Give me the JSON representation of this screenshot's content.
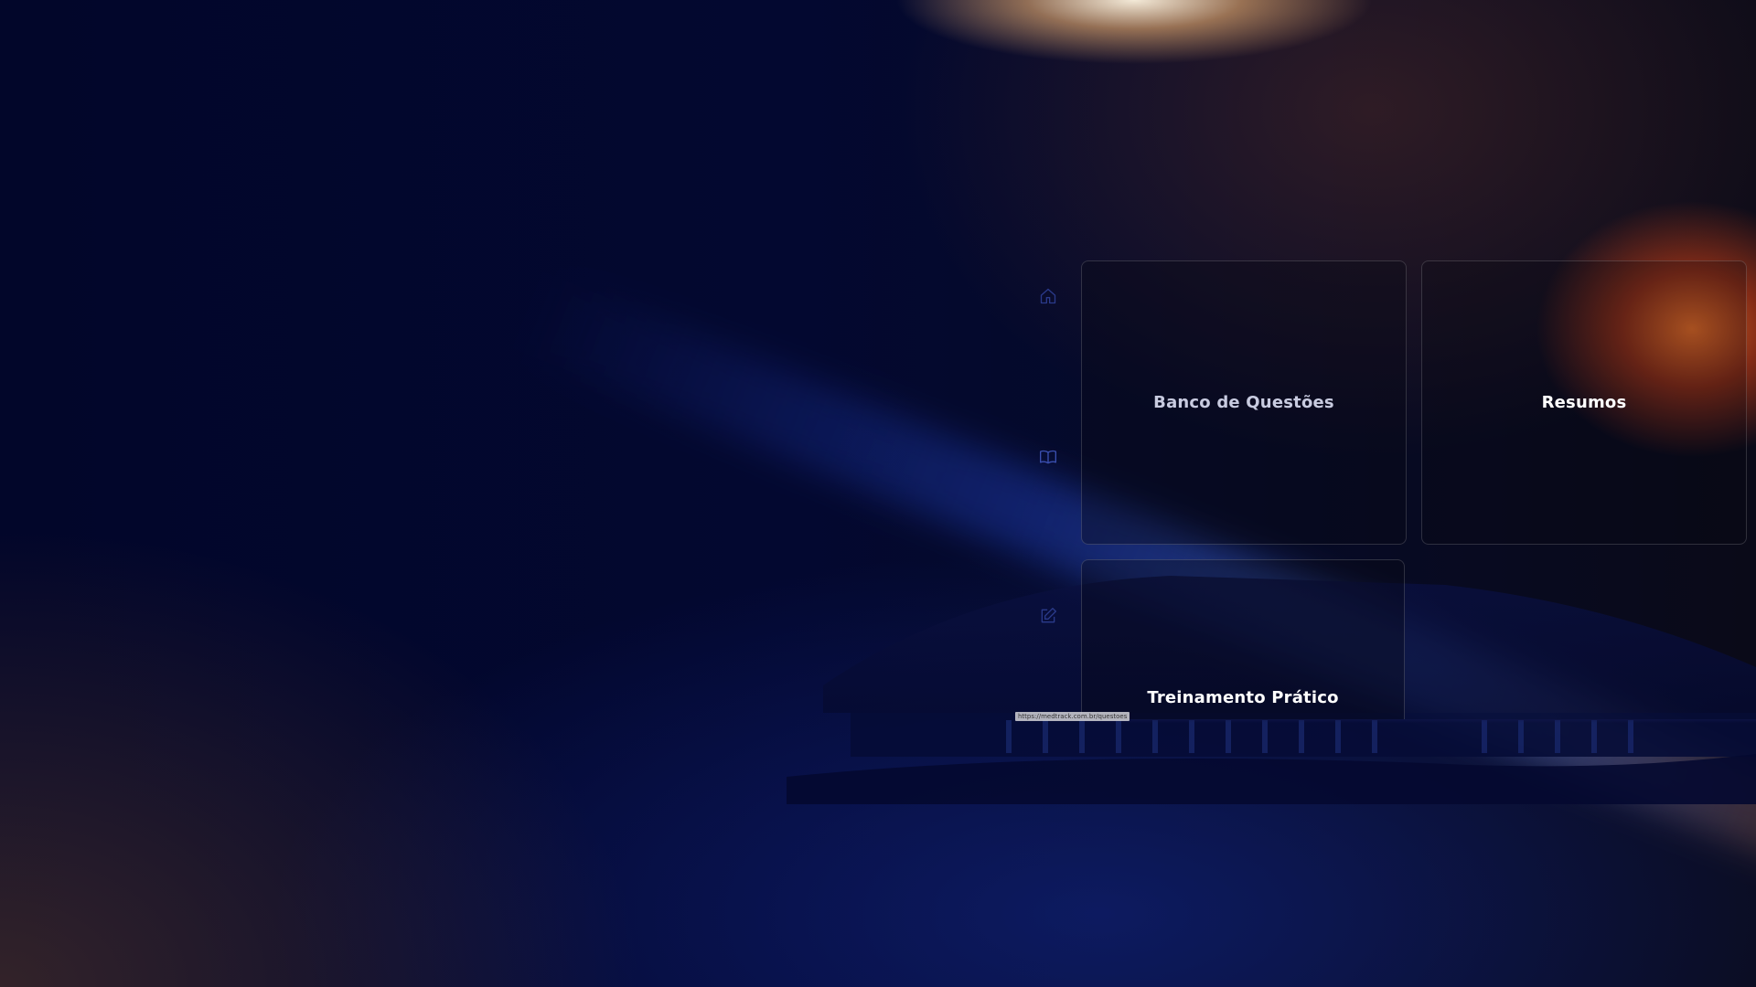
{
  "sidebar": {
    "items": [
      {
        "icon": "home-icon",
        "label": ""
      },
      {
        "icon": "book-open-icon",
        "label": ""
      },
      {
        "icon": "edit-icon",
        "label": ""
      }
    ]
  },
  "cards": {
    "question_bank": "Banco de Questões",
    "summaries": "Resumos",
    "practical_training": "Treinamento Prático"
  },
  "status_url": "https://medtrack.com.br/questoes",
  "colors": {
    "background": "#02062a",
    "card_border": "#ffffff29",
    "text": "#ffffff",
    "icon": "#3a4fb0"
  }
}
